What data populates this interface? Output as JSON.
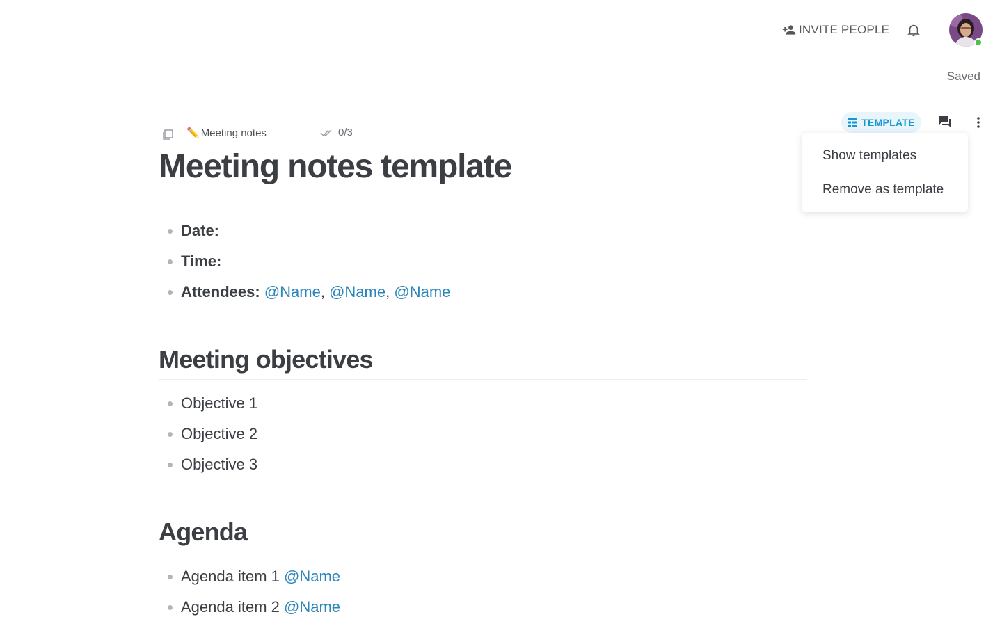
{
  "header": {
    "invite_label": "INVITE PEOPLE",
    "status": "Saved"
  },
  "doc_bar": {
    "doc_emoji": "✏️",
    "doc_name": "Meeting notes",
    "task_count": "0/3"
  },
  "toolbar": {
    "template_label": "TEMPLATE"
  },
  "template_menu": {
    "items": [
      "Show templates",
      "Remove as template"
    ]
  },
  "document": {
    "title": "Meeting notes template",
    "fields": {
      "date_label": "Date:",
      "time_label": "Time:",
      "attendees_label": "Attendees:",
      "attendees": [
        "@Name",
        "@Name",
        "@Name"
      ],
      "separator": ","
    },
    "objectives": {
      "heading": "Meeting objectives",
      "items": [
        "Objective 1",
        "Objective 2",
        "Objective 3"
      ]
    },
    "agenda": {
      "heading": "Agenda",
      "items": [
        {
          "text": "Agenda item 1",
          "mention": "@Name"
        },
        {
          "text": "Agenda item 2",
          "mention": "@Name"
        }
      ]
    }
  },
  "colors": {
    "accent": "#1797d2",
    "mention": "#2b85b8",
    "presence": "#4cc248",
    "text": "#3b3f44"
  }
}
